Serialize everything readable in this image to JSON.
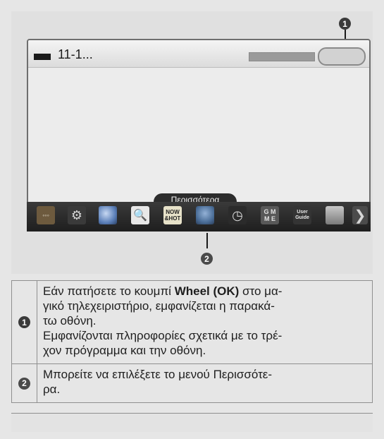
{
  "callouts": {
    "one": "1",
    "two": "2"
  },
  "tv_screen": {
    "channel_number": "11-1...",
    "more_tab_label": "Περισσότερα"
  },
  "menu_icons": [
    {
      "name": "input-icon",
      "glyph": "◦◦◦"
    },
    {
      "name": "settings-icon",
      "glyph": "⚙"
    },
    {
      "name": "globe-icon",
      "glyph": ""
    },
    {
      "name": "search-icon",
      "glyph": "🔍"
    },
    {
      "name": "now-hot-icon",
      "glyph": "NOW\n&HOT"
    },
    {
      "name": "apps-icon",
      "glyph": ""
    },
    {
      "name": "clock-icon",
      "glyph": "◷"
    },
    {
      "name": "game-icon",
      "glyph": "G M\nM E"
    },
    {
      "name": "user-guide-icon",
      "glyph": "User\nGuide"
    },
    {
      "name": "list-icon",
      "glyph": ""
    },
    {
      "name": "next-icon",
      "glyph": "❯"
    }
  ],
  "table": {
    "row1_line1_prefix": "Εάν πατήσετε το κουμπί ",
    "row1_bold": "Wheel (OK)",
    "row1_line1_suffix": " στο μα-",
    "row1_line2": "γικό τηλεχειριστήριο, εμφανίζεται η παρακά-",
    "row1_line3": "τω οθόνη.",
    "row1_line4": "Εμφανίζονται πληροφορίες σχετικά με το τρέ-",
    "row1_line5": "χον πρόγραμμα και την οθόνη.",
    "row2_line1": "Μπορείτε να επιλέξετε το μενού Περισσότε-",
    "row2_line2": "ρα."
  }
}
